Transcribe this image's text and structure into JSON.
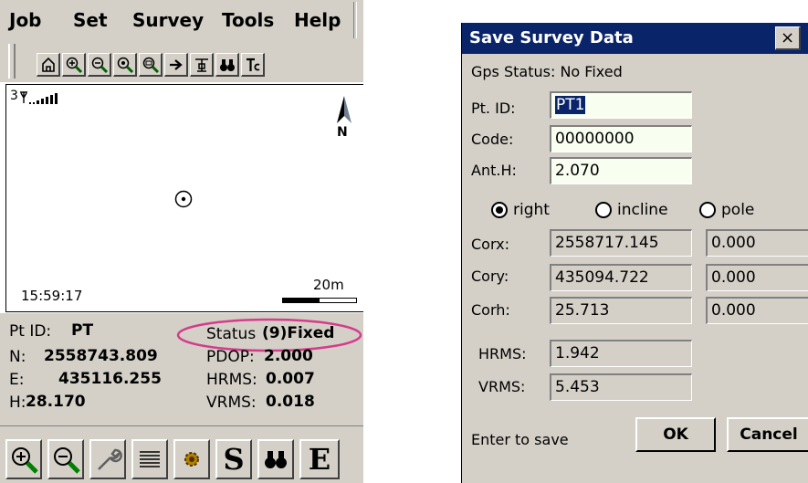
{
  "left": {
    "menu": [
      "Job",
      "Set",
      "Survey",
      "Tools",
      "Help"
    ],
    "toolbar_icons": [
      "home-icon",
      "zoom-in-icon",
      "zoom-out-icon",
      "zoom-extent-icon",
      "zoom-window-icon",
      "arrow-right-icon",
      "antenna-icon",
      "binoculars-icon",
      "text-icon"
    ],
    "map": {
      "satellites": "3",
      "north_label": "N",
      "time": "15:59:17",
      "scale": "20m"
    },
    "info": {
      "pt_id_label": "Pt ID:",
      "pt_id": "PT",
      "status_label": "Status",
      "status_value": "(9)Fixed",
      "n_label": "N:",
      "n_value": "2558743.809",
      "e_label": "E:",
      "e_value": "435116.255",
      "h_label": "H:",
      "h_value": "28.170",
      "pdop_label": "PDOP:",
      "pdop_value": "2.000",
      "hrms_label": "HRMS:",
      "hrms_value": "0.007",
      "vrms_label": "VRMS:",
      "vrms_value": "0.018"
    },
    "bottom_icons": [
      "zoom-in-icon",
      "zoom-out-icon",
      "wrench-icon",
      "list-icon",
      "gear-icon",
      "s-icon",
      "binoculars-icon",
      "e-icon"
    ],
    "bottom_s": "S",
    "bottom_e": "E",
    "highlight_color": "#d43c8c"
  },
  "dialog": {
    "title": "Save Survey Data",
    "close": "×",
    "gps_status": "Gps Status: No Fixed",
    "pt_id_label": "Pt. ID:",
    "pt_id_value": "PT1",
    "code_label": "Code:",
    "code_value": "00000000",
    "anth_label": "Ant.H:",
    "anth_value": "2.070",
    "radios": [
      {
        "label": "right",
        "selected": true
      },
      {
        "label": "incline",
        "selected": false
      },
      {
        "label": "pole",
        "selected": false
      }
    ],
    "corx_label": "Corx:",
    "corx_value": "2558717.145",
    "corx_offset": "0.000",
    "cory_label": "Cory:",
    "cory_value": "435094.722",
    "cory_offset": "0.000",
    "corh_label": "Corh:",
    "corh_value": "25.713",
    "corh_offset": "0.000",
    "hrms_label": "HRMS:",
    "hrms_value": "1.942",
    "vrms_label": "VRMS:",
    "vrms_value": "5.453",
    "footer_text": "Enter to save",
    "ok_label": "OK",
    "cancel_label": "Cancel",
    "title_color": "#0a246a"
  }
}
